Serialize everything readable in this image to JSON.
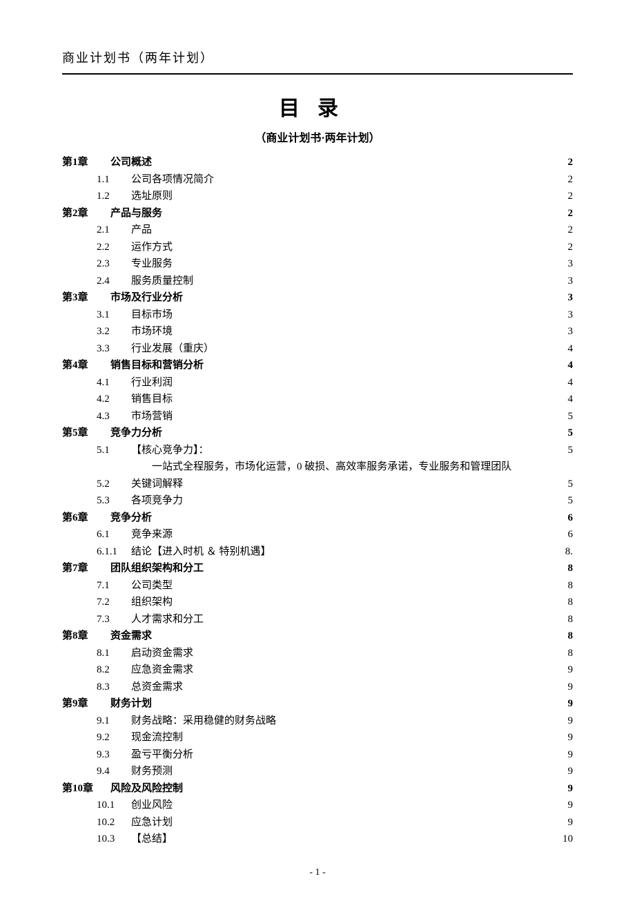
{
  "header": "商业计划书（两年计划）",
  "title": "目录",
  "subtitle": "（商业计划书·两年计划）",
  "page_number": "- 1 -",
  "toc": [
    {
      "level": "chapter",
      "num": "第1章",
      "text": "公司概述",
      "page": "2"
    },
    {
      "level": "sub",
      "num": "1.1",
      "text": "公司各项情况简介",
      "page": "2"
    },
    {
      "level": "sub",
      "num": "1.2",
      "text": "选址原则",
      "page": "2"
    },
    {
      "level": "chapter",
      "num": "第2章",
      "text": "产品与服务",
      "page": "2"
    },
    {
      "level": "sub",
      "num": "2.1",
      "text": "产品",
      "page": "2"
    },
    {
      "level": "sub",
      "num": "2.2",
      "text": "运作方式",
      "page": "2"
    },
    {
      "level": "sub",
      "num": "2.3",
      "text": "专业服务",
      "page": "3"
    },
    {
      "level": "sub",
      "num": "2.4",
      "text": "服务质量控制",
      "page": "3"
    },
    {
      "level": "chapter",
      "num": "第3章",
      "text": "市场及行业分析",
      "page": "3"
    },
    {
      "level": "sub",
      "num": "3.1",
      "text": "目标市场",
      "page": "3"
    },
    {
      "level": "sub",
      "num": "3.2",
      "text": "市场环境",
      "page": "3"
    },
    {
      "level": "sub",
      "num": "3.3",
      "text": "行业发展（重庆）",
      "page": "4"
    },
    {
      "level": "chapter",
      "num": "第4章",
      "text": "销售目标和营销分析",
      "page": "4"
    },
    {
      "level": "sub",
      "num": "4.1",
      "text": "行业利润",
      "page": "4"
    },
    {
      "level": "sub",
      "num": "4.2",
      "text": "销售目标",
      "page": "4"
    },
    {
      "level": "sub",
      "num": "4.3",
      "text": "市场营销",
      "page": "5"
    },
    {
      "level": "chapter",
      "num": "第5章",
      "text": "竞争力分析",
      "page": "5"
    },
    {
      "level": "sub",
      "num": "5.1",
      "text": "【核心竞争力】：",
      "page": "5",
      "bold": true
    },
    {
      "level": "note",
      "text": "一站式全程服务，市场化运营，0 破损、高效率服务承诺，专业服务和管理团队"
    },
    {
      "level": "sub",
      "num": "5.2",
      "text": "关键词解释",
      "page": "5"
    },
    {
      "level": "sub",
      "num": "5.3",
      "text": "各项竞争力",
      "page": "5"
    },
    {
      "level": "chapter",
      "num": "第6章",
      "text": "竞争分析",
      "page": "6"
    },
    {
      "level": "sub",
      "num": "6.1",
      "text": "竞争来源",
      "page": "6"
    },
    {
      "level": "sub3",
      "num": "6.1.1",
      "text": "结论【进入时机 ＆ 特别机遇】",
      "page": "8."
    },
    {
      "level": "chapter",
      "num": "第7章",
      "text": "团队组织架构和分工",
      "page": "8"
    },
    {
      "level": "sub",
      "num": "7.1",
      "text": "公司类型",
      "page": "8"
    },
    {
      "level": "sub",
      "num": "7.2",
      "text": "组织架构",
      "page": "8"
    },
    {
      "level": "sub",
      "num": "7.3",
      "text": "人才需求和分工",
      "page": "8"
    },
    {
      "level": "chapter",
      "num": "第8章",
      "text": "资金需求",
      "page": "8"
    },
    {
      "level": "sub",
      "num": "8.1",
      "text": "启动资金需求",
      "page": "8"
    },
    {
      "level": "sub",
      "num": "8.2",
      "text": "应急资金需求",
      "page": "9"
    },
    {
      "level": "sub",
      "num": "8.3",
      "text": "总资金需求",
      "page": "9"
    },
    {
      "level": "chapter",
      "num": "第9章",
      "text": "财务计划",
      "page": "9"
    },
    {
      "level": "sub",
      "num": "9.1",
      "text": "财务战略：采用稳健的财务战略",
      "page": "9",
      "bold": true
    },
    {
      "level": "sub",
      "num": "9.2",
      "text": "现金流控制",
      "page": "9"
    },
    {
      "level": "sub",
      "num": "9.3",
      "text": "盈亏平衡分析",
      "page": "9"
    },
    {
      "level": "sub",
      "num": "9.4",
      "text": "财务预测",
      "page": "9"
    },
    {
      "level": "chapter",
      "num": "第10章",
      "text": "风险及风险控制",
      "page": "9"
    },
    {
      "level": "sub",
      "num": "10.1",
      "text": "创业风险",
      "page": "9"
    },
    {
      "level": "sub",
      "num": "10.2",
      "text": "应急计划",
      "page": "9"
    },
    {
      "level": "sub",
      "num": "10.3",
      "text": "【总结】",
      "page": "10",
      "bold": true
    }
  ]
}
